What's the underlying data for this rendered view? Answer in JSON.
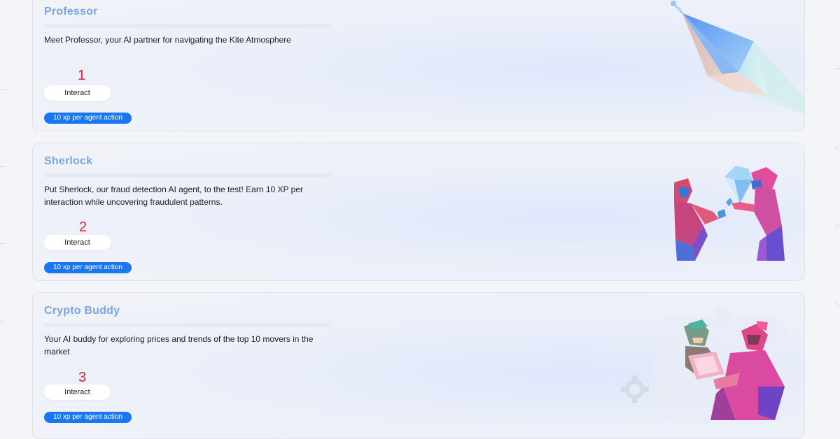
{
  "agents": [
    {
      "title": "Professor",
      "description": "Meet Professor, your AI partner for navigating the Kite Atmosphere",
      "marker": "1",
      "button_label": "Interact",
      "badge": "10 xp per agent action"
    },
    {
      "title": "Sherlock",
      "description": "Put Sherlock, our fraud detection AI agent, to the test! Earn 10 XP per interaction while uncovering fraudulent patterns.",
      "marker": "2",
      "button_label": "Interact",
      "badge": "10 xp per agent action"
    },
    {
      "title": "Crypto Buddy",
      "description": "Your AI buddy for exploring prices and trends of the top 10 movers in the market",
      "marker": "3",
      "button_label": "Interact",
      "badge": "10 xp per agent action"
    }
  ],
  "colors": {
    "title": "#7aa6e0",
    "badge_bg": "#1877f2",
    "marker": "#e0203c",
    "page_bg": "#f4f5f8"
  },
  "icons": [
    "crystal-diamond-art",
    "two-figures-crystal-art",
    "two-people-laptop-art"
  ]
}
